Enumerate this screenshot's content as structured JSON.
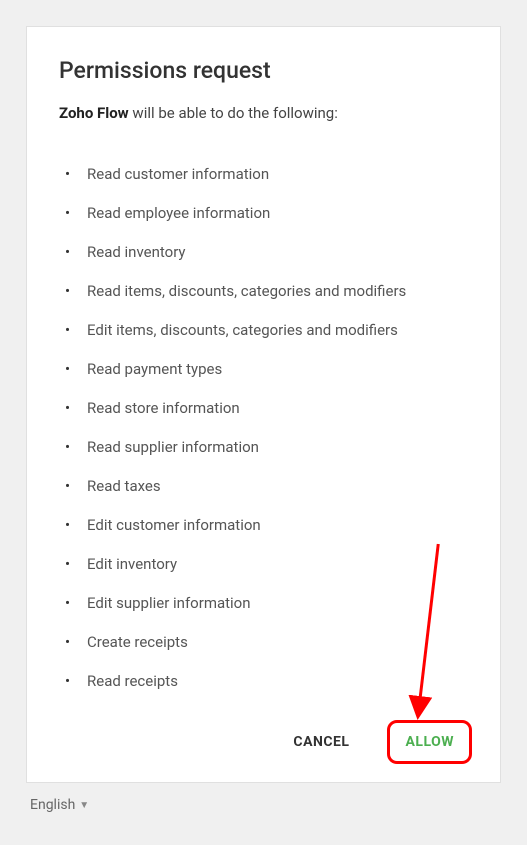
{
  "dialog": {
    "title": "Permissions request",
    "app_name": "Zoho Flow",
    "intro_suffix": " will be able to do the following:",
    "permissions": [
      "Read customer information",
      "Read employee information",
      "Read inventory",
      "Read items, discounts, categories and modifiers",
      "Edit items, discounts, categories and modifiers",
      "Read payment types",
      "Read store information",
      "Read supplier information",
      "Read taxes",
      "Edit customer information",
      "Edit inventory",
      "Edit supplier information",
      "Create receipts",
      "Read receipts"
    ],
    "cancel_label": "CANCEL",
    "allow_label": "ALLOW"
  },
  "footer": {
    "language_label": "English"
  },
  "annotation": {
    "highlight_target": "allow-button"
  }
}
